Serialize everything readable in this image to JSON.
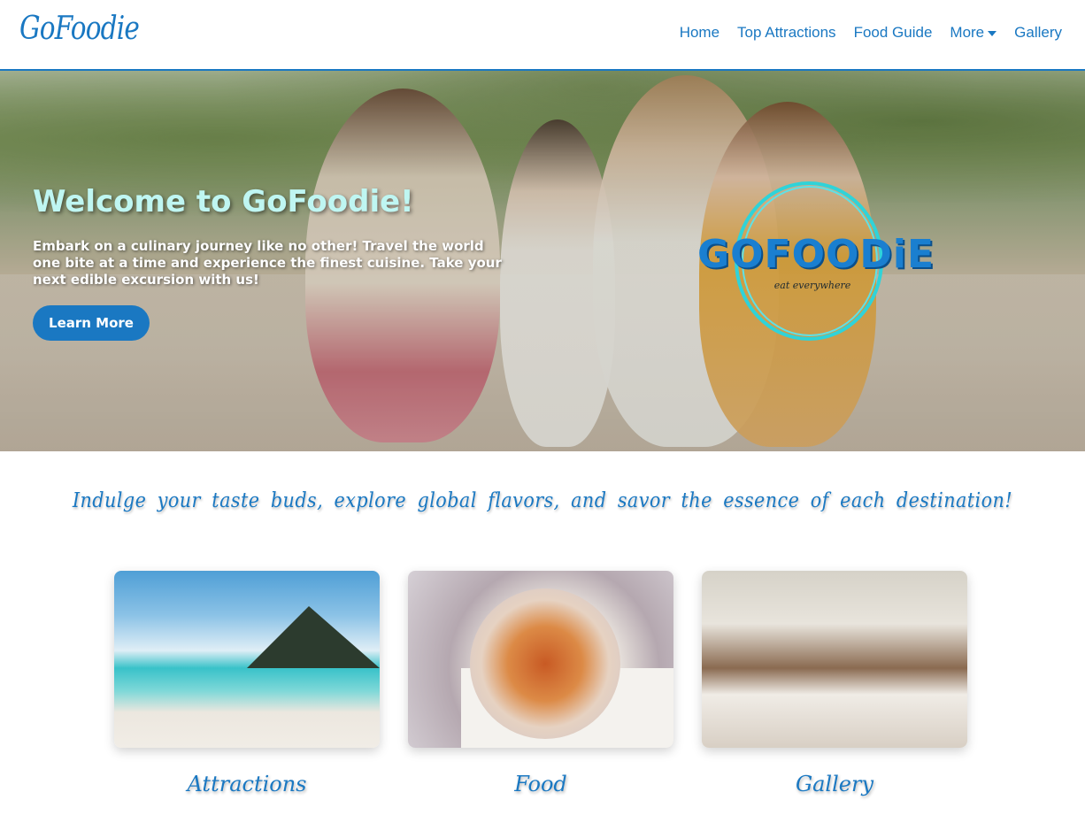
{
  "header": {
    "logo": "GoFoodie",
    "nav": [
      {
        "label": "Home"
      },
      {
        "label": "Top Attractions"
      },
      {
        "label": "Food Guide"
      },
      {
        "label": "More"
      },
      {
        "label": "Gallery"
      }
    ]
  },
  "hero": {
    "title": "Welcome to GoFoodie!",
    "text": "Embark on a culinary journey like no other! Travel the world one bite at a time and experience the finest cuisine. Take your next edible excursion with us!",
    "button_label": "Learn More",
    "badge_title": "GOFOODiE",
    "badge_subtitle": "eat everywhere"
  },
  "tagline": "Indulge your taste buds, explore global flavors, and savor the essence of each destination!",
  "cards": [
    {
      "label": "Attractions"
    },
    {
      "label": "Food"
    },
    {
      "label": "Gallery"
    }
  ],
  "colors": {
    "brand_blue": "#1a78c2",
    "hero_title": "#bff6f2",
    "badge_ring": "#2fd3d9"
  }
}
